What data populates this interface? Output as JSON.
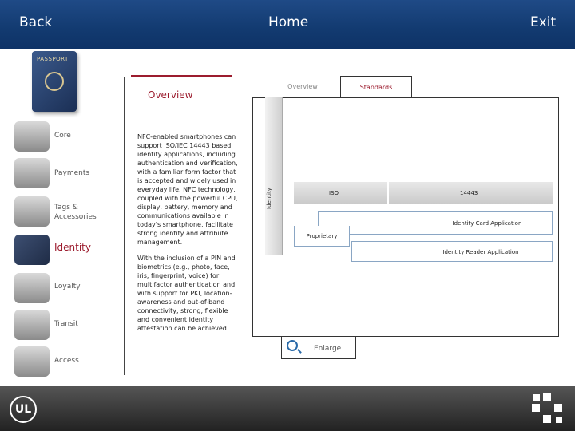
{
  "header": {
    "back_label": "Back",
    "home_label": "Home",
    "exit_label": "Exit"
  },
  "passport": {
    "cover_text": "PASSPORT"
  },
  "main": {
    "heading": "Overview"
  },
  "sidebar": {
    "items": [
      {
        "label": "Core"
      },
      {
        "label": "Payments"
      },
      {
        "label": "Tags & Accessories"
      },
      {
        "label": "Identity"
      },
      {
        "label": "Loyalty"
      },
      {
        "label": "Transit"
      },
      {
        "label": "Access"
      }
    ]
  },
  "description": {
    "paragraph1": "NFC-enabled smartphones can support ISO/IEC 14443 based identity applications, including authentication and verification, with a familiar form factor that is accepted and widely used in everyday life. NFC technology, coupled with the powerful CPU, display, battery, memory and communications available in today's smartphone, facilitate strong identity and attribute management.",
    "paragraph2": "With the inclusion of a PIN and biometrics (e.g., photo, face, iris, fingerprint, voice) for multifactor authentication and with support for PKI, location-awareness and out-of-band connectivity, strong, flexible and convenient identity attestation can be achieved."
  },
  "diagram": {
    "tabs": {
      "overview": "Overview",
      "standards": "Standards"
    },
    "identity_label": "Identity",
    "iso_label": "ISO",
    "iso_number": "14443",
    "card_app": "Identity Card Application",
    "proprietary": "Proprietary",
    "reader_app": "Identity Reader Application",
    "enlarge_label": "Enlarge"
  },
  "footer": {
    "ul_logo": "UL"
  },
  "colors": {
    "header_blue": "#123a70",
    "accent_red": "#9c1c2e",
    "footer_gray": "#333333"
  }
}
